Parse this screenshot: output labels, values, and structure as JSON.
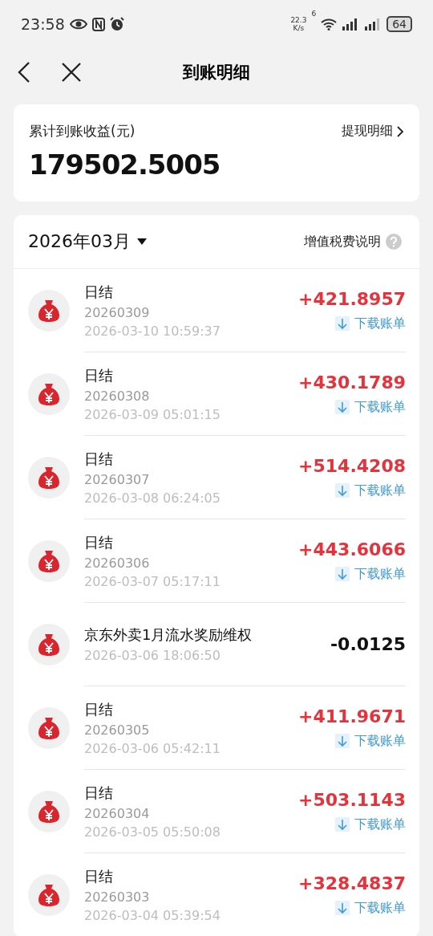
{
  "status_bar": {
    "time": "23:58",
    "net_speed": "22.3",
    "net_unit": "K/s",
    "wifi_tag": "6",
    "battery": "64"
  },
  "header": {
    "title": "到账明细"
  },
  "summary": {
    "label": "累计到账收益(元)",
    "link": "提现明细",
    "total": "179502.5005"
  },
  "month_bar": {
    "month": "2026年03月",
    "tax_note": "增值税费说明"
  },
  "rows": [
    {
      "kind": "daily",
      "title": "日结",
      "code": "20260309",
      "time": "2026-03-10 10:59:37",
      "amount": "+421.8957",
      "download": "下载账单"
    },
    {
      "kind": "daily",
      "title": "日结",
      "code": "20260308",
      "time": "2026-03-09 05:01:15",
      "amount": "+430.1789",
      "download": "下载账单"
    },
    {
      "kind": "daily",
      "title": "日结",
      "code": "20260307",
      "time": "2026-03-08 06:24:05",
      "amount": "+514.4208",
      "download": "下载账单"
    },
    {
      "kind": "daily",
      "title": "日结",
      "code": "20260306",
      "time": "2026-03-07 05:17:11",
      "amount": "+443.6066",
      "download": "下载账单"
    },
    {
      "kind": "deduction",
      "title": "京东外卖1月流水奖励维权",
      "time": "2026-03-06 18:06:50",
      "amount": "-0.0125"
    },
    {
      "kind": "daily",
      "title": "日结",
      "code": "20260305",
      "time": "2026-03-06 05:42:11",
      "amount": "+411.9671",
      "download": "下载账单"
    },
    {
      "kind": "daily",
      "title": "日结",
      "code": "20260304",
      "time": "2026-03-05 05:50:08",
      "amount": "+503.1143",
      "download": "下载账单"
    },
    {
      "kind": "daily",
      "title": "日结",
      "code": "20260303",
      "time": "2026-03-04 05:39:54",
      "amount": "+328.4837",
      "download": "下载账单"
    }
  ]
}
